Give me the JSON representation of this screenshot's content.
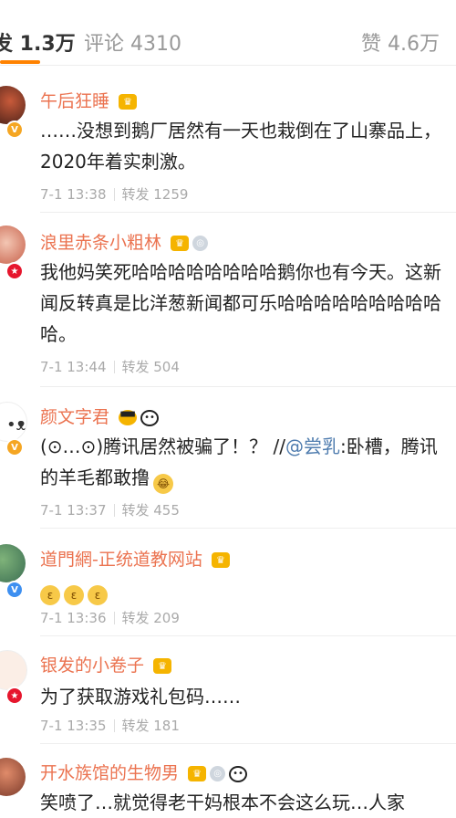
{
  "tabs": {
    "repost": "发 1.3万",
    "comment": "评论 4310",
    "like": "赞 4.6万"
  },
  "comments": [
    {
      "name": "午后狂睡",
      "text": "……没想到鹅厂居然有一天也栽倒在了山寨品上，2020年着实刺激。",
      "time": "7-1 13:38",
      "repost": "转发 1259",
      "badges": [
        "crown-icon"
      ]
    },
    {
      "name": "浪里赤条小粗林",
      "text": "我他妈笑死哈哈哈哈哈哈哈哈鹅你也有今天。这新闻反转真是比洋葱新闻都可乐哈哈哈哈哈哈哈哈哈哈。",
      "time": "7-1 13:44",
      "repost": "转发 504",
      "badges": [
        "crown-icon",
        "medal-icon"
      ]
    },
    {
      "name": "颜文字君",
      "text_prefix": "(⊙…⊙)腾讯居然被骗了！？ //",
      "mention": "@尝乳",
      "text_suffix": ":卧槽，腾讯的羊毛都敢撸",
      "time": "7-1 13:37",
      "repost": "转发 455",
      "badges": [
        "sunglasses-icon",
        "panda-icon"
      ]
    },
    {
      "name": "道門網-正统道教网站",
      "text": "",
      "time": "7-1 13:36",
      "repost": "转发 209",
      "badges": [
        "crown-icon"
      ]
    },
    {
      "name": "银发的小卷子",
      "text": "为了获取游戏礼包码……",
      "time": "7-1 13:35",
      "repost": "转发 181",
      "badges": [
        "crown-icon"
      ]
    },
    {
      "name": "开水族馆的生物男",
      "text": "笑喷了…就觉得老干妈根本不会这么玩…人家",
      "badges": [
        "crown-icon",
        "medal-icon",
        "panda-icon"
      ]
    }
  ]
}
